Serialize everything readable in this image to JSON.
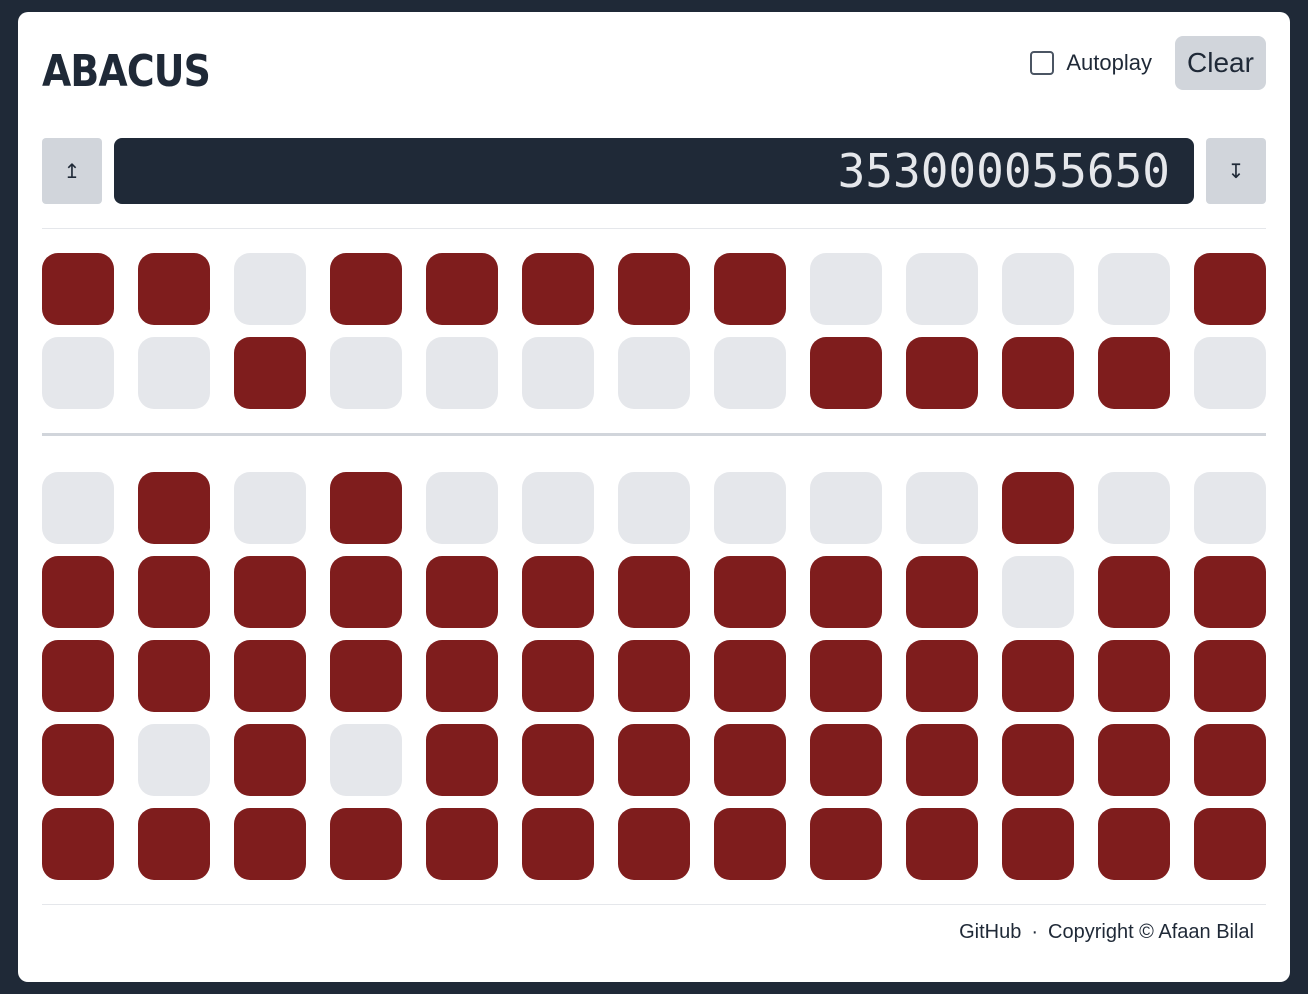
{
  "app": {
    "title": "ABACUS"
  },
  "controls": {
    "autoplay_label": "Autoplay",
    "autoplay_checked": false,
    "clear_label": "Clear"
  },
  "display": {
    "value": "353000055650",
    "shift_up_icon": "↥",
    "shift_down_icon": "↧"
  },
  "beads": {
    "heaven": [
      [
        1,
        1,
        0,
        1,
        1,
        1,
        1,
        1,
        0,
        0,
        0,
        0,
        1
      ],
      [
        0,
        0,
        1,
        0,
        0,
        0,
        0,
        0,
        1,
        1,
        1,
        1,
        0
      ]
    ],
    "earth": [
      [
        0,
        1,
        0,
        1,
        0,
        0,
        0,
        0,
        0,
        0,
        1,
        0,
        0
      ],
      [
        1,
        1,
        1,
        1,
        1,
        1,
        1,
        1,
        1,
        1,
        0,
        1,
        1
      ],
      [
        1,
        1,
        1,
        1,
        1,
        1,
        1,
        1,
        1,
        1,
        1,
        1,
        1
      ],
      [
        1,
        0,
        1,
        0,
        1,
        1,
        1,
        1,
        1,
        1,
        1,
        1,
        1
      ],
      [
        1,
        1,
        1,
        1,
        1,
        1,
        1,
        1,
        1,
        1,
        1,
        1,
        1
      ]
    ]
  },
  "colors": {
    "bead_on": "#7f1d1d",
    "bead_off": "#e5e7eb",
    "display_bg": "#1f2937"
  },
  "footer": {
    "github_label": "GitHub",
    "separator": "·",
    "copyright": "Copyright © Afaan Bilal"
  }
}
